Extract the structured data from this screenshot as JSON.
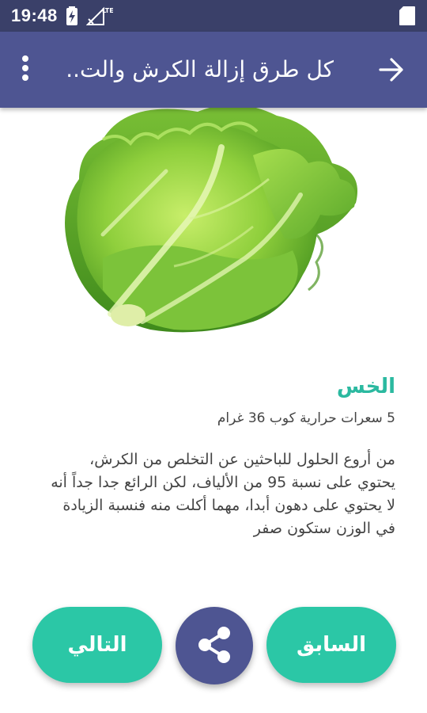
{
  "status_bar": {
    "time": "19:48",
    "network_label": "LTE",
    "icons": [
      "battery-charging-icon",
      "no-signal-lte-icon",
      "sd-card-icon"
    ]
  },
  "app_bar": {
    "title": "كل طرق إزالة الكرش والت...",
    "icons": [
      "back-arrow-icon",
      "overflow-menu-icon"
    ]
  },
  "content": {
    "image_subject": "lettuce",
    "title": "الخس",
    "meta": "5 سعرات حرارية كوب 36  غرام",
    "description": "من أروع الحلول للباحثين عن التخلص من الكرش، يحتوي على نسبة 95 من الألياف، لكن الرائع جدا جداً أنه لا يحتوي على دهون أبدا، مهما أكلت منه فنسبة الزيادة في الوزن ستكون صفر"
  },
  "buttons": {
    "next_label": "التالي",
    "previous_label": "السابق",
    "share_icon": "share-icon"
  },
  "colors": {
    "status_bar": "#3a4069",
    "app_bar": "#4e5592",
    "accent": "#2bc7a6",
    "title_text": "#2bb9a0"
  }
}
